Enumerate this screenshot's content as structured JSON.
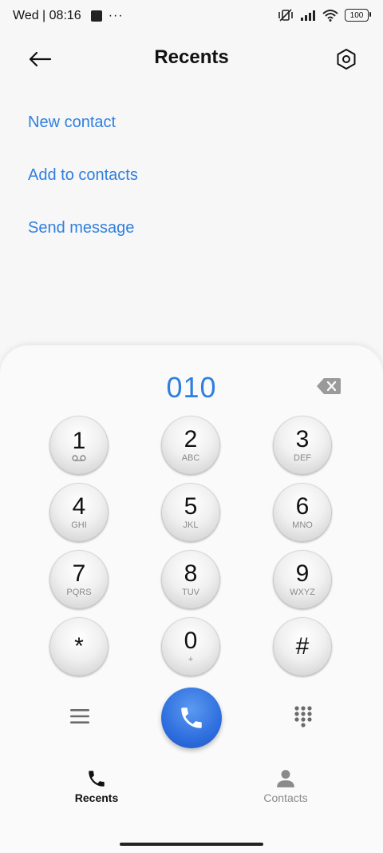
{
  "status": {
    "time": "Wed | 08:16",
    "dots": "···",
    "battery": "100"
  },
  "header": {
    "title": "Recents"
  },
  "actions": [
    {
      "label": "New contact"
    },
    {
      "label": "Add to contacts"
    },
    {
      "label": "Send message"
    }
  ],
  "dialer": {
    "number": "010",
    "keys": [
      {
        "digit": "1",
        "sub": ""
      },
      {
        "digit": "2",
        "sub": "ABC"
      },
      {
        "digit": "3",
        "sub": "DEF"
      },
      {
        "digit": "4",
        "sub": "GHI"
      },
      {
        "digit": "5",
        "sub": "JKL"
      },
      {
        "digit": "6",
        "sub": "MNO"
      },
      {
        "digit": "7",
        "sub": "PQRS"
      },
      {
        "digit": "8",
        "sub": "TUV"
      },
      {
        "digit": "9",
        "sub": "WXYZ"
      },
      {
        "digit": "*",
        "sub": ""
      },
      {
        "digit": "0",
        "sub": "+"
      },
      {
        "digit": "#",
        "sub": ""
      }
    ]
  },
  "tabs": [
    {
      "label": "Recents",
      "active": true
    },
    {
      "label": "Contacts",
      "active": false
    }
  ],
  "colors": {
    "accent": "#2f7fe0",
    "call": "#2f6fdf"
  }
}
